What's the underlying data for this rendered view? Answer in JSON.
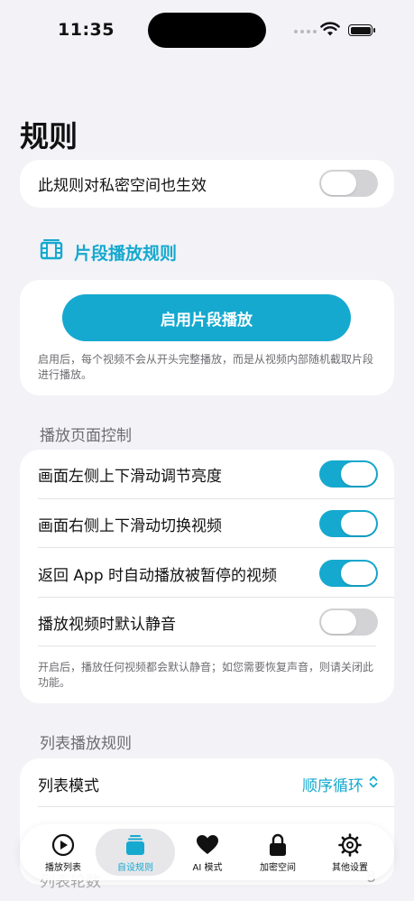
{
  "status_bar": {
    "time": "11:35"
  },
  "page": {
    "title": "规则"
  },
  "private_space_rule": {
    "label": "此规则对私密空间也生效",
    "enabled": false
  },
  "clip_section": {
    "title": "片段播放规则",
    "button_label": "启用片段播放",
    "description": "启用后，每个视频不会从开头完整播放，而是从视频内部随机截取片段进行播放。"
  },
  "playback_controls": {
    "header": "播放页面控制",
    "items": [
      {
        "label": "画面左侧上下滑动调节亮度",
        "enabled": true
      },
      {
        "label": "画面右侧上下滑动切换视频",
        "enabled": true
      },
      {
        "label": "返回 App 时自动播放被暂停的视频",
        "enabled": true
      },
      {
        "label": "播放视频时默认静音",
        "enabled": false
      }
    ],
    "description": "开启后，播放任何视频都会默认静音；如您需要恢复声音，则请关闭此功能。"
  },
  "list_rules": {
    "header": "列表播放规则",
    "mode_label": "列表模式",
    "mode_value": "顺序循环",
    "next_label": "列表轮数",
    "next_value": "8"
  },
  "tab_bar": {
    "tabs": [
      {
        "label": "播放列表",
        "icon": "play-circle-icon"
      },
      {
        "label": "自设规则",
        "icon": "stack-icon",
        "active": true
      },
      {
        "label": "AI 模式",
        "icon": "heart-icon"
      },
      {
        "label": "加密空间",
        "icon": "lock-icon"
      },
      {
        "label": "其他设置",
        "icon": "gear-icon"
      }
    ]
  },
  "colors": {
    "accent": "#15a9cf",
    "background": "#f2f2f7",
    "toggle_off": "#d3d3d6"
  }
}
